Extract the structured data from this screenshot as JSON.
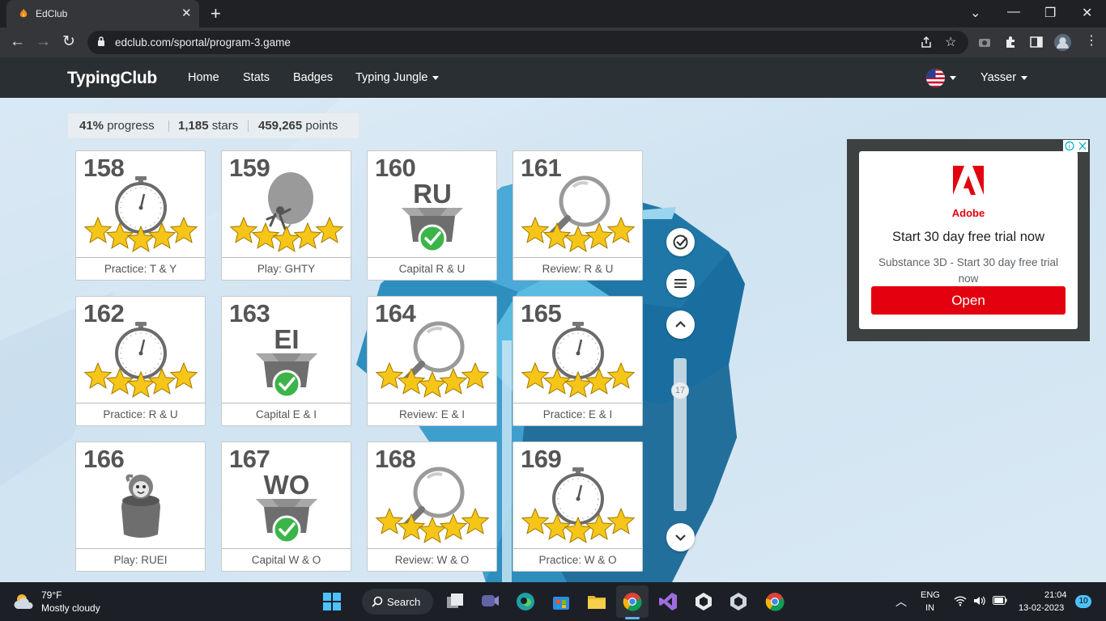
{
  "browser": {
    "tab_title": "EdClub",
    "url": "edclub.com/sportal/program-3.game"
  },
  "site": {
    "logo": "TypingClub",
    "nav": [
      "Home",
      "Stats",
      "Badges",
      "Typing Jungle"
    ],
    "user": "Yasser"
  },
  "progress": {
    "percent": "41%",
    "percent_label": "progress",
    "stars": "1,185",
    "stars_label": "stars",
    "points": "459,265",
    "points_label": "points"
  },
  "lessons": [
    {
      "num": "158",
      "label": "Practice: T & Y",
      "icon": "stopwatch-icon",
      "stars": 5
    },
    {
      "num": "159",
      "label": "Play: GHTY",
      "icon": "balloon-icon",
      "stars": 5
    },
    {
      "num": "160",
      "label": "Capital R & U",
      "icon": "box-check-icon",
      "caps": "RU"
    },
    {
      "num": "161",
      "label": "Review: R & U",
      "icon": "magnifier-icon",
      "stars": 5
    },
    {
      "num": "162",
      "label": "Practice: R & U",
      "icon": "stopwatch-icon",
      "stars": 5
    },
    {
      "num": "163",
      "label": "Capital E & I",
      "icon": "box-check-icon",
      "caps": "EI"
    },
    {
      "num": "164",
      "label": "Review: E & I",
      "icon": "magnifier-icon",
      "stars": 5
    },
    {
      "num": "165",
      "label": "Practice: E & I",
      "icon": "stopwatch-icon",
      "stars": 5
    },
    {
      "num": "166",
      "label": "Play: RUEI",
      "icon": "bucket-creature-icon",
      "stars": 0
    },
    {
      "num": "167",
      "label": "Capital W & O",
      "icon": "box-check-icon",
      "caps": "WO"
    },
    {
      "num": "168",
      "label": "Review: W & O",
      "icon": "magnifier-icon",
      "stars": 5
    },
    {
      "num": "169",
      "label": "Practice: W & O",
      "icon": "stopwatch-icon",
      "stars": 5
    }
  ],
  "scroll": {
    "page": "17"
  },
  "ad": {
    "brand": "Adobe",
    "headline": "Start 30 day free trial now",
    "subtext": "Substance 3D - Start 30 day free trial now",
    "button": "Open"
  },
  "taskbar": {
    "temp": "79°F",
    "weather": "Mostly cloudy",
    "search": "Search",
    "lang1": "ENG",
    "lang2": "IN",
    "time": "21:04",
    "date": "13-02-2023",
    "badge": "10"
  },
  "colors": {
    "header": "#2a2f33",
    "star": "#f5c518",
    "check": "#3bb54a",
    "ad_red": "#e3000f"
  }
}
